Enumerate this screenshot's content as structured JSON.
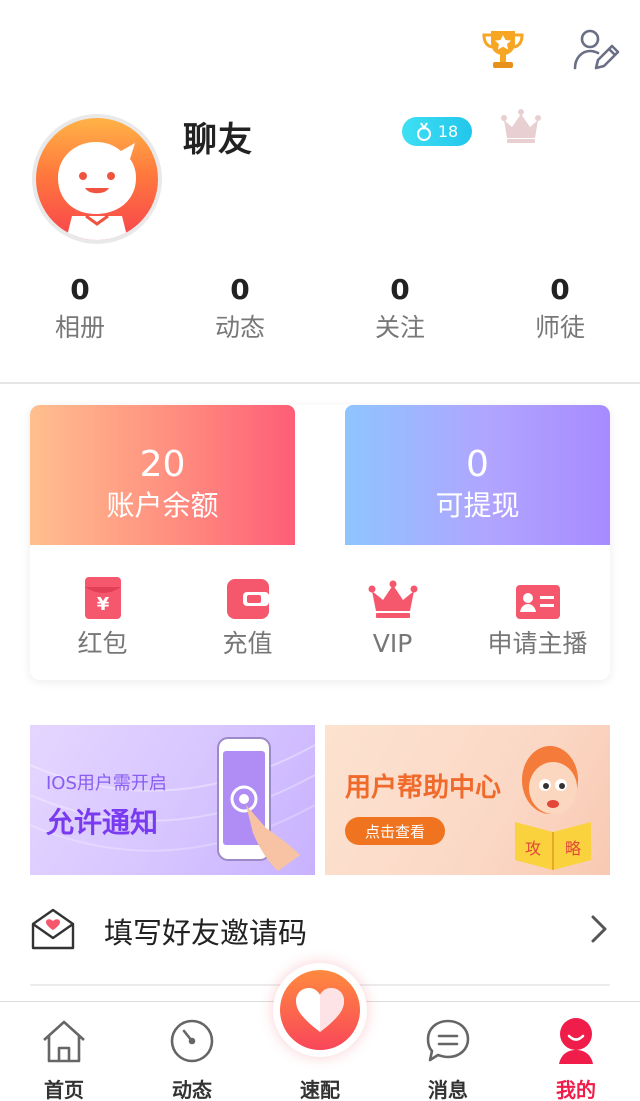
{
  "profile": {
    "nickname": "聊友",
    "level": "18",
    "stats": [
      {
        "value": "0",
        "label": "相册"
      },
      {
        "value": "0",
        "label": "动态"
      },
      {
        "value": "0",
        "label": "关注"
      },
      {
        "value": "0",
        "label": "师徒"
      }
    ]
  },
  "header": {
    "icons": [
      "trophy-icon",
      "edit-profile-icon"
    ]
  },
  "wallet": {
    "balance": {
      "value": "20",
      "label": "账户余额"
    },
    "withdrawable": {
      "value": "0",
      "label": "可提现"
    },
    "actions": [
      {
        "label": "红包",
        "icon": "red-envelope-icon"
      },
      {
        "label": "充值",
        "icon": "wallet-icon"
      },
      {
        "label": "VIP",
        "icon": "crown-icon"
      },
      {
        "label": "申请主播",
        "icon": "id-card-icon"
      }
    ]
  },
  "banners": {
    "notify": {
      "line1": "IOS用户需开启",
      "line2": "允许通知"
    },
    "help": {
      "title": "用户帮助中心",
      "button": "点击查看",
      "book1": "攻",
      "book2": "略"
    }
  },
  "invite": {
    "label": "填写好友邀请码"
  },
  "tabs": [
    {
      "label": "首页",
      "icon": "home-icon"
    },
    {
      "label": "动态",
      "icon": "dial-icon"
    },
    {
      "label": "速配",
      "icon": "heart-icon"
    },
    {
      "label": "消息",
      "icon": "message-icon"
    },
    {
      "label": "我的",
      "icon": "profile-icon"
    }
  ],
  "colors": {
    "accent": "#f01c4a",
    "level_badge": "#22c6ec",
    "withdraw_card": "#a68bff",
    "balance_card": "#fd5e77"
  }
}
